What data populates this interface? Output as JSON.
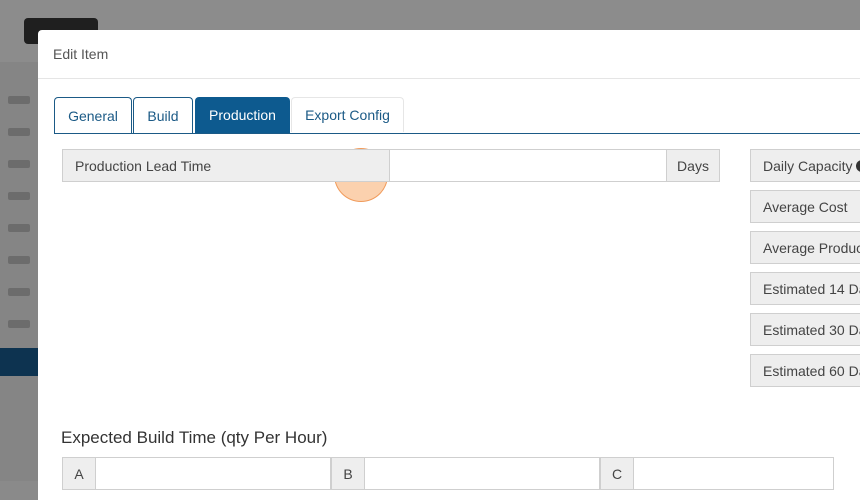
{
  "modal": {
    "title": "Edit Item"
  },
  "tabs": [
    {
      "label": "General"
    },
    {
      "label": "Build"
    },
    {
      "label": "Production"
    },
    {
      "label": "Export Config"
    }
  ],
  "production": {
    "lead_time_label": "Production Lead Time",
    "lead_time_value": "",
    "lead_time_unit": "Days"
  },
  "stats": [
    {
      "label": "Daily Capacity",
      "icon": "info-icon"
    },
    {
      "label": "Average Cost"
    },
    {
      "label": "Average Product"
    },
    {
      "label": "Estimated 14 Da"
    },
    {
      "label": "Estimated 30 Da"
    },
    {
      "label": "Estimated 60 Da"
    }
  ],
  "build_time": {
    "title": "Expected Build Time (qty Per Hour)",
    "fields": [
      {
        "label": "A"
      },
      {
        "label": "B"
      },
      {
        "label": "C"
      }
    ]
  },
  "colors": {
    "primary": "#0d5a8f",
    "addon_bg": "#eeeeee",
    "cursor": "#f7ab6b"
  }
}
